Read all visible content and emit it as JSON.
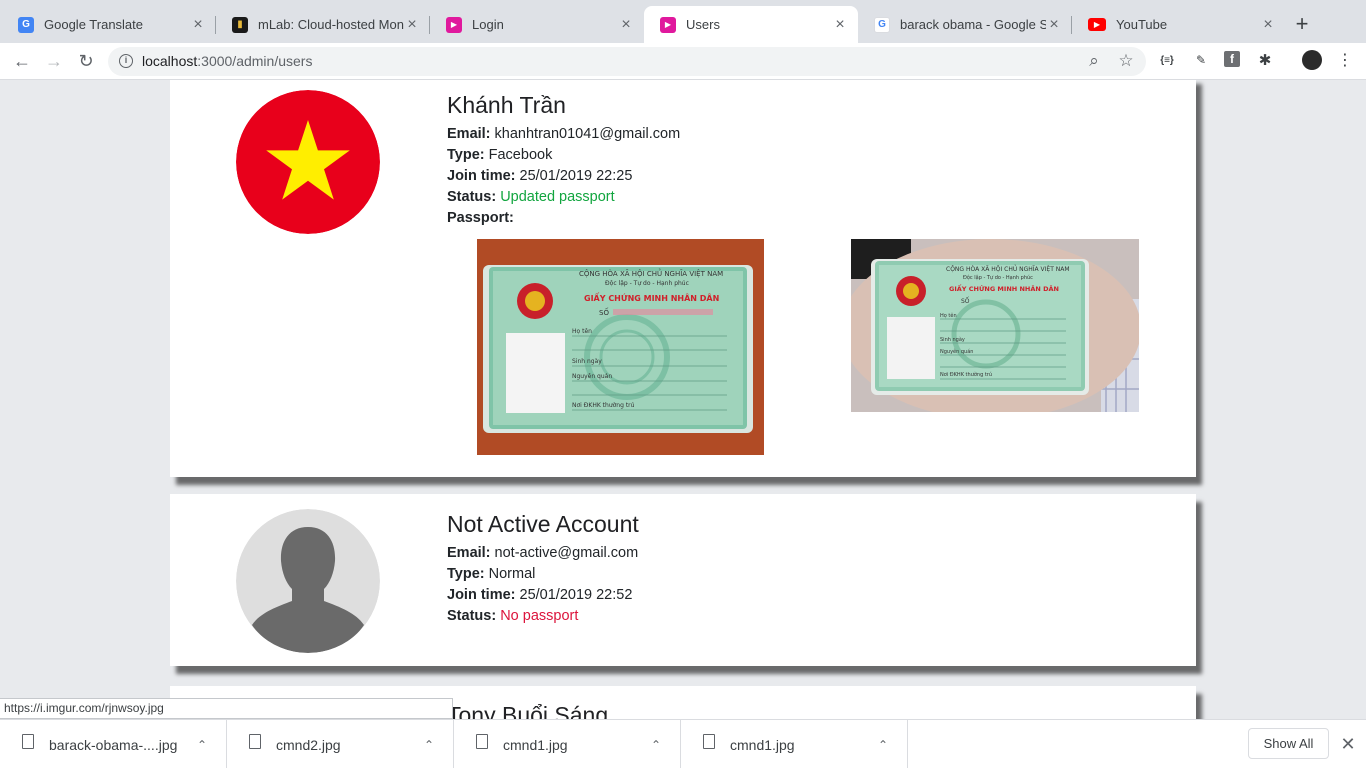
{
  "tabs": [
    {
      "title": "Google Translate",
      "icon": "google-translate-icon",
      "color": "#4285f4",
      "glyph": "G"
    },
    {
      "title": "mLab: Cloud-hosted Mong",
      "icon": "mlab-icon",
      "color": "#1a1a1a",
      "glyph": "▮"
    },
    {
      "title": "Login",
      "icon": "play-icon",
      "color": "#e0199d",
      "glyph": "▶"
    },
    {
      "title": "Users",
      "icon": "play-icon",
      "color": "#e0199d",
      "glyph": "▶",
      "active": true
    },
    {
      "title": "barack obama - Google Se",
      "icon": "google-icon",
      "color": "#ffffff",
      "glyph": "G"
    },
    {
      "title": "YouTube",
      "icon": "youtube-icon",
      "color": "#ff0000",
      "glyph": "▶"
    }
  ],
  "toolbar": {
    "back": "←",
    "forward": "→",
    "reload": "↻",
    "url_host": "localhost",
    "url_path": ":3000/admin/users",
    "zoom_icon": "⌕",
    "star_icon": "☆",
    "ext1": "{≡}",
    "ext2": "✎",
    "ext3": "f",
    "ext4": "✱",
    "menu": "⋮"
  },
  "users": [
    {
      "name": "Khánh Trần",
      "email_label": "Email:",
      "email": "khanhtran01041@gmail.com",
      "type_label": "Type:",
      "type": "Facebook",
      "join_label": "Join time:",
      "join": "25/01/2019 22:25",
      "status_label": "Status:",
      "status": "Updated passport",
      "status_color": "#12a53f",
      "passport_label": "Passport:"
    },
    {
      "name": "Not Active Account",
      "email_label": "Email:",
      "email": "not-active@gmail.com",
      "type_label": "Type:",
      "type": "Normal",
      "join_label": "Join time:",
      "join": "25/01/2019 22:52",
      "status_label": "Status:",
      "status": "No passport",
      "status_color": "#dc143c"
    },
    {
      "name": "Tony Buổi Sáng"
    }
  ],
  "id_card_text": {
    "header": "CỘNG HÒA XÃ HỘI CHỦ NGHĨA VIỆT NAM",
    "motto": "Độc lập - Tự do - Hạnh phúc",
    "title": "GIẤY CHỨNG MINH NHÂN DÂN",
    "number_label": "SỐ",
    "name_label": "Họ tên",
    "dob_label": "Sinh ngày",
    "origin_label": "Nguyên quán",
    "residence_label": "Nơi ĐKHK thường trú"
  },
  "status_bar": {
    "url": "https://i.imgur.com/rjnwsoy.jpg"
  },
  "downloads": {
    "items": [
      {
        "name": "barack-obama-....jpg"
      },
      {
        "name": "cmnd2.jpg"
      },
      {
        "name": "cmnd1.jpg"
      },
      {
        "name": "cmnd1.jpg"
      }
    ],
    "caret": "⌃",
    "show_all": "Show All",
    "close": "✕"
  }
}
